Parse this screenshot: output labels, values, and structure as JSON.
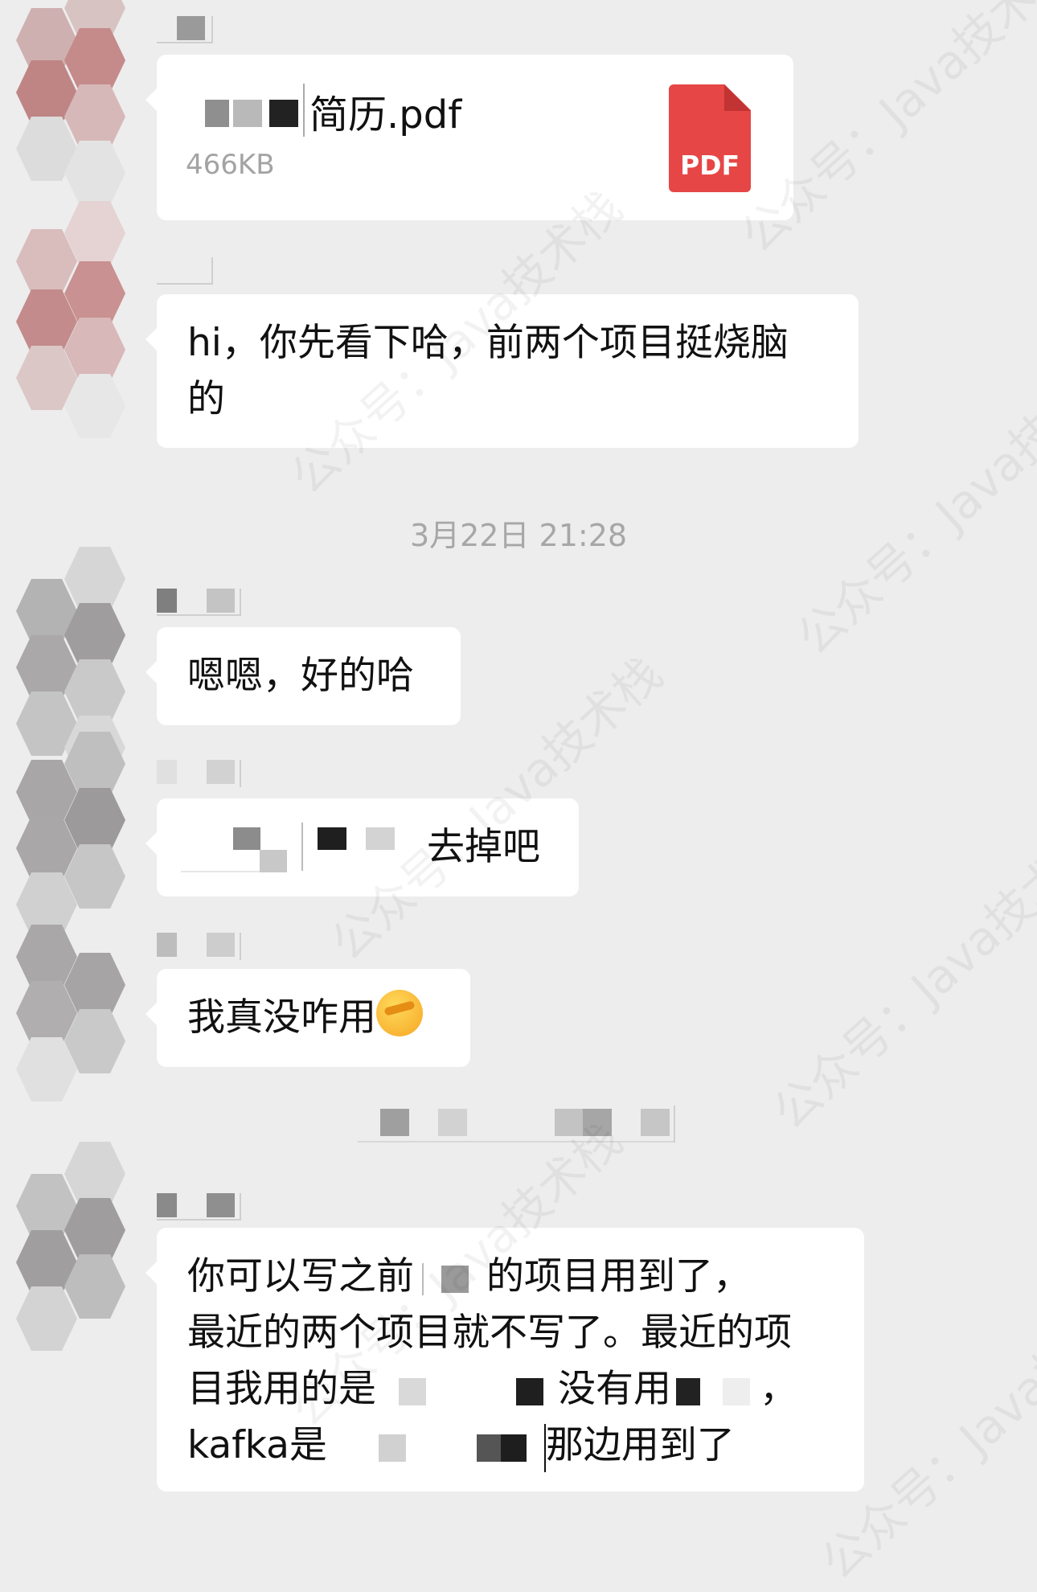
{
  "messages": [
    {
      "type": "file",
      "file_name": "简历.pdf",
      "file_size": "466KB",
      "file_icon_label": "PDF"
    },
    {
      "type": "text",
      "lines": [
        "hi，你先看下哈，前两个项目挺烧脑",
        "的"
      ]
    },
    {
      "type": "text",
      "lines": [
        "嗯嗯，好的哈"
      ]
    },
    {
      "type": "text",
      "lines": [
        "去掉吧"
      ]
    },
    {
      "type": "text",
      "lines": [
        "我真没咋用"
      ],
      "emoji": "facepalm-laughing-emoji"
    },
    {
      "type": "text",
      "line1_a": "你可以写之前",
      "line1_b": "的项目用到了，",
      "line2": "最近的两个项目就不写了。最近的项",
      "line3_a": "目我用的是",
      "line3_b": "没有用",
      "line3_c": "，",
      "line4_a": "kafka是",
      "line4_b": "那边用到了"
    }
  ],
  "timestamp": "3月22日 21:28",
  "watermark": "公众号：Java技术栈",
  "colors": {
    "background": "#ededed",
    "bubble": "#ffffff",
    "pdf": "#e64646"
  }
}
